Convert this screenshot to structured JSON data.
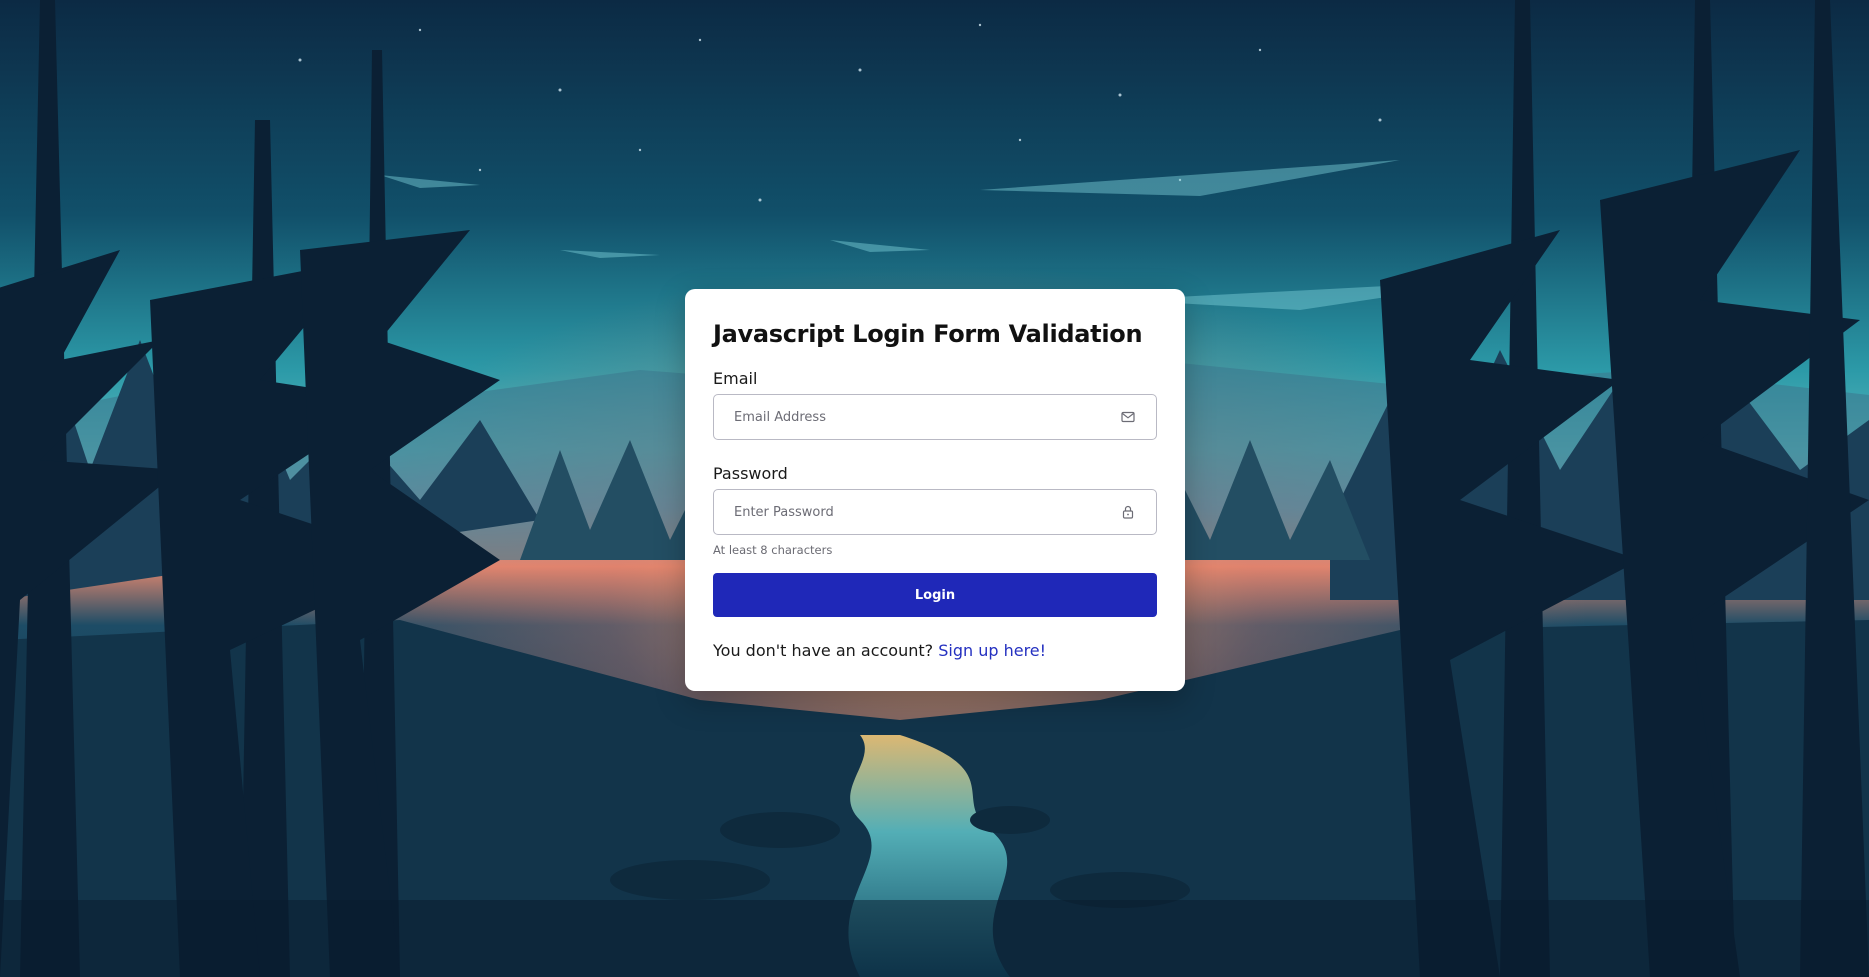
{
  "form": {
    "title": "Javascript Login Form Validation",
    "email": {
      "label": "Email",
      "placeholder": "Email Address",
      "value": "",
      "icon": "envelope-icon"
    },
    "password": {
      "label": "Password",
      "placeholder": "Enter Password",
      "value": "",
      "icon": "lock-icon",
      "hint": "At least 8 characters"
    },
    "login_label": "Login",
    "signup_prompt": "You don't have an account?",
    "signup_link": "Sign up here!"
  },
  "colors": {
    "button": "#1f28b8",
    "link": "#2430c0",
    "card": "#ffffff"
  }
}
